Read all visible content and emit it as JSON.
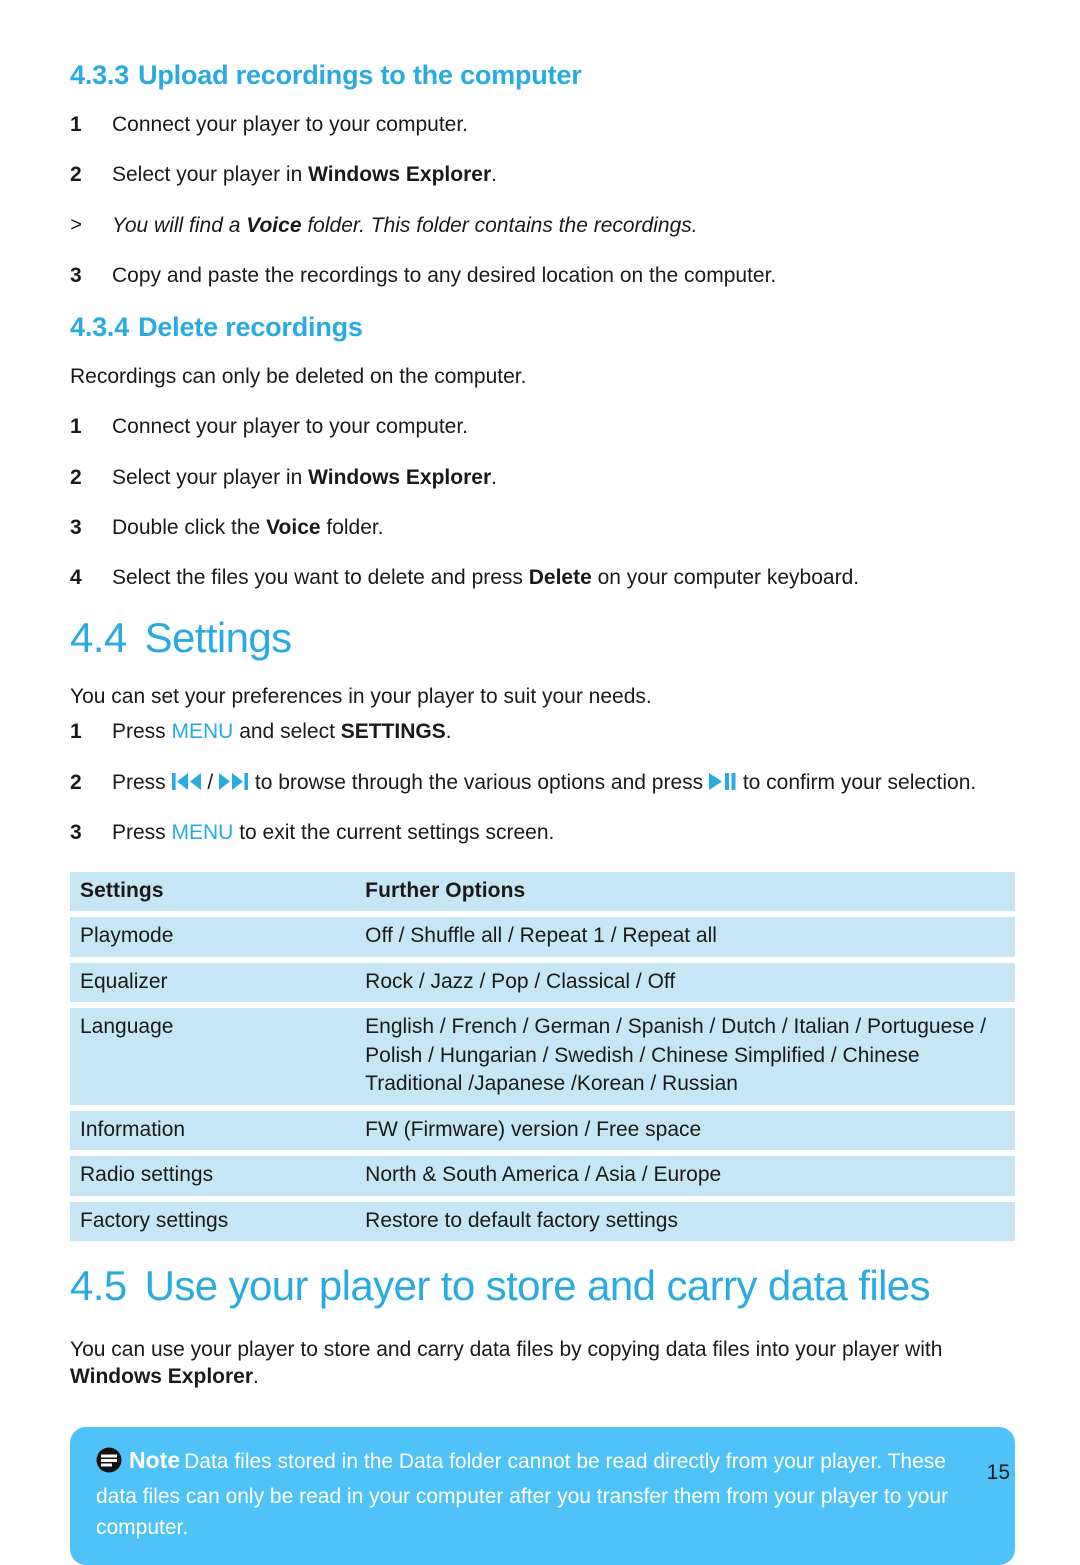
{
  "document": {
    "page_number": "15",
    "accent_color": "#29abe2",
    "table_header_color": "#4fc3f7",
    "table_row_color": "#c6e6f5",
    "note_box_color": "#4fc3f7"
  },
  "section_433": {
    "number": "4.3.3",
    "title": "Upload recordings to the computer",
    "steps": [
      {
        "marker": "1",
        "style": "normal",
        "parts": [
          {
            "text": "Connect your player to your computer.",
            "style": "normal"
          }
        ]
      },
      {
        "marker": "2",
        "style": "normal",
        "parts": [
          {
            "text": "Select your player in ",
            "style": "normal"
          },
          {
            "text": "Windows Explorer",
            "style": "bold"
          },
          {
            "text": ".",
            "style": "normal"
          }
        ]
      },
      {
        "marker": ">",
        "style": "italic",
        "parts": [
          {
            "text": "You will find a ",
            "style": "normal"
          },
          {
            "text": "Voice",
            "style": "bold"
          },
          {
            "text": " folder. This folder contains the recordings.",
            "style": "normal"
          }
        ]
      },
      {
        "marker": "3",
        "style": "normal",
        "parts": [
          {
            "text": "Copy and paste the recordings to any desired location on the computer.",
            "style": "normal"
          }
        ]
      }
    ]
  },
  "section_434": {
    "number": "4.3.4",
    "title": "Delete recordings",
    "intro": "Recordings can only be deleted on the computer.",
    "steps": [
      {
        "marker": "1",
        "style": "normal",
        "parts": [
          {
            "text": "Connect your player to your computer.",
            "style": "normal"
          }
        ]
      },
      {
        "marker": "2",
        "style": "normal",
        "parts": [
          {
            "text": "Select your player in ",
            "style": "normal"
          },
          {
            "text": "Windows Explorer",
            "style": "bold"
          },
          {
            "text": ".",
            "style": "normal"
          }
        ]
      },
      {
        "marker": "3",
        "style": "normal",
        "parts": [
          {
            "text": "Double click the ",
            "style": "normal"
          },
          {
            "text": "Voice",
            "style": "bold"
          },
          {
            "text": " folder.",
            "style": "normal"
          }
        ]
      },
      {
        "marker": "4",
        "style": "normal",
        "parts": [
          {
            "text": "Select the files you want to delete and press ",
            "style": "normal"
          },
          {
            "text": "Delete",
            "style": "bold"
          },
          {
            "text": " on your computer keyboard.",
            "style": "normal"
          }
        ]
      }
    ]
  },
  "section_44": {
    "number": "4.4",
    "title": "Settings",
    "intro": "You can set your preferences in your player to suit your needs.",
    "steps": [
      {
        "marker": "1",
        "style": "normal",
        "parts": [
          {
            "text": "Press ",
            "style": "normal"
          },
          {
            "text": "MENU",
            "style": "accent"
          },
          {
            "text": " and select ",
            "style": "normal"
          },
          {
            "text": "SETTINGS",
            "style": "bold"
          },
          {
            "text": ".",
            "style": "normal"
          }
        ]
      },
      {
        "marker": "2",
        "style": "normal",
        "parts": [
          {
            "text": "Press ",
            "style": "normal"
          },
          {
            "icon": "previous-track-icon"
          },
          {
            "text": " / ",
            "style": "normal"
          },
          {
            "icon": "next-track-icon"
          },
          {
            "text": " to browse through the various options and press ",
            "style": "normal"
          },
          {
            "icon": "play-pause-icon"
          },
          {
            "text": " to confirm your selection.",
            "style": "normal"
          }
        ]
      },
      {
        "marker": "3",
        "style": "normal",
        "parts": [
          {
            "text": "Press ",
            "style": "normal"
          },
          {
            "text": "MENU",
            "style": "accent"
          },
          {
            "text": " to exit the current settings screen.",
            "style": "normal"
          }
        ]
      }
    ],
    "settings_table": {
      "headers": [
        "Settings",
        "Further Options"
      ],
      "rows": [
        {
          "setting": "Playmode",
          "options": [
            "Off / Shuffle all / Repeat 1 / Repeat all"
          ]
        },
        {
          "setting": "Equalizer",
          "options": [
            "Rock / Jazz / Pop / Classical / Off"
          ]
        },
        {
          "setting": "Language",
          "options": [
            "English / French / German / Spanish / Dutch / Italian / Portuguese /",
            "Polish / Hungarian / Swedish / Chinese Simplified / Chinese",
            "Traditional /Japanese /Korean / Russian"
          ]
        },
        {
          "setting": "Information",
          "options": [
            "FW (Firmware) version / Free space"
          ]
        },
        {
          "setting": "Radio settings",
          "options": [
            "North & South America / Asia / Europe"
          ]
        },
        {
          "setting": "Factory settings",
          "options": [
            "Restore to default factory settings"
          ]
        }
      ]
    }
  },
  "section_45": {
    "number": "4.5",
    "title": "Use your player to store and carry data files",
    "body_parts": [
      {
        "text": "You can use your player to store and carry data files by copying data files into your player with ",
        "style": "normal"
      },
      {
        "text": "Windows Explorer",
        "style": "bold"
      },
      {
        "text": ".",
        "style": "normal"
      }
    ]
  },
  "note": {
    "icon": "note-icon",
    "label": "Note",
    "text": "Data files stored in the Data folder cannot be read directly from your player. These data files can only be read in your computer after you transfer them from your player to your computer."
  }
}
